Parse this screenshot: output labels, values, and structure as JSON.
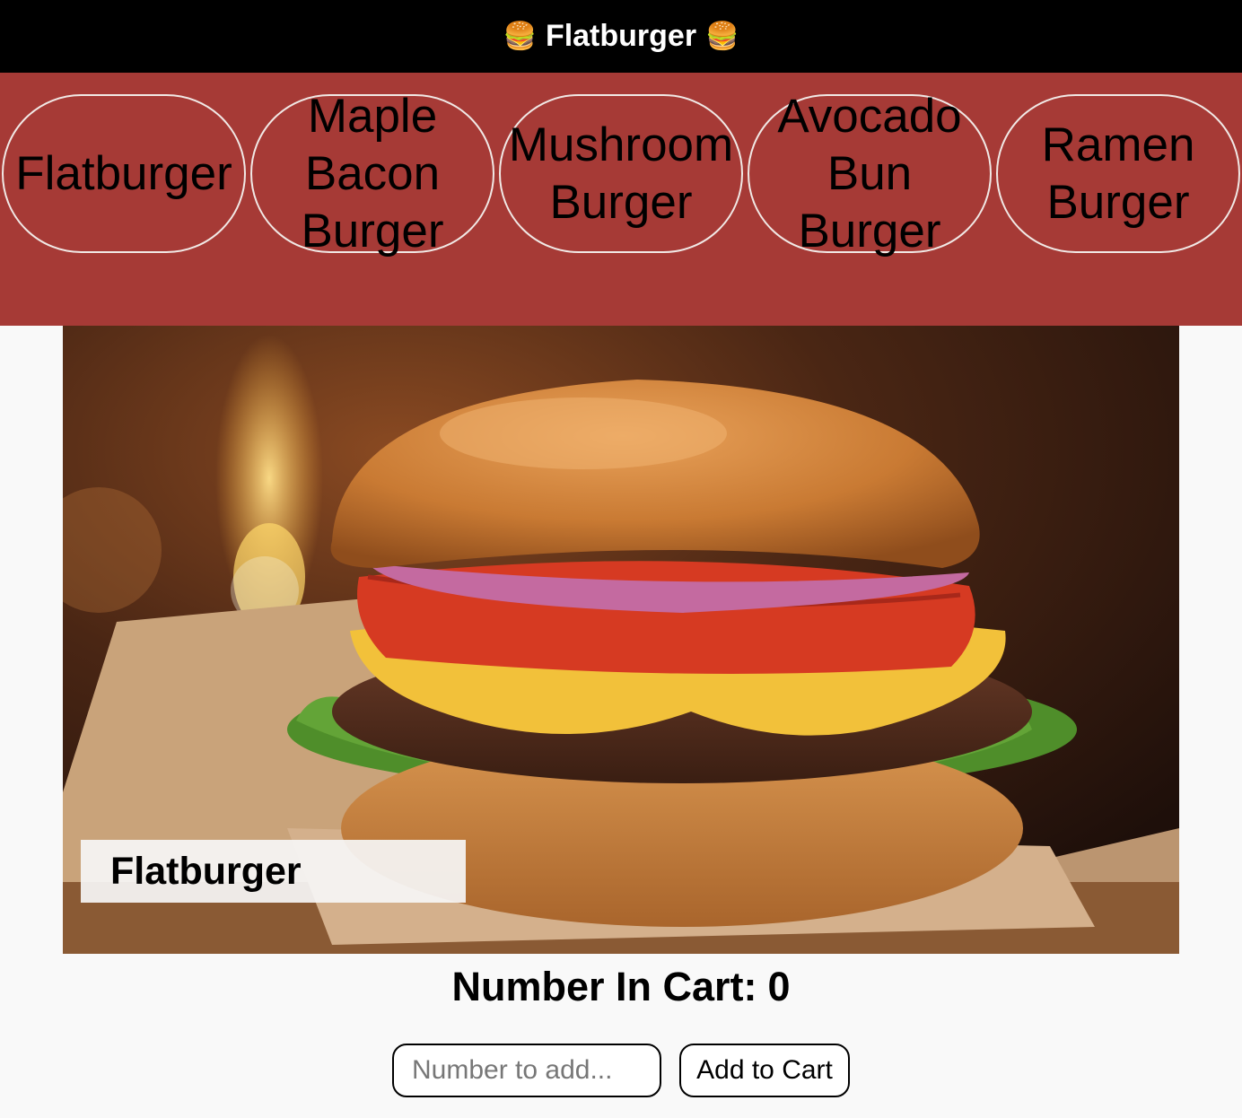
{
  "header": {
    "title": "Flatburger",
    "left_icon": "burger-emoji-icon",
    "right_icon": "burger-emoji-icon",
    "emoji": "🍔"
  },
  "nav": {
    "background_color": "#a63a36",
    "items": [
      {
        "label": "Flatburger"
      },
      {
        "label": "Maple Bacon Burger"
      },
      {
        "label": "Mushroom Burger"
      },
      {
        "label": "Avocado Bun Burger"
      },
      {
        "label": "Ramen Burger"
      }
    ]
  },
  "detail": {
    "image_alt": "cheeseburger-photo",
    "name": "Flatburger"
  },
  "cart": {
    "label": "Number In Cart:",
    "count": "0",
    "input_placeholder": "Number to add...",
    "input_value": "",
    "button_label": "Add to Cart"
  }
}
